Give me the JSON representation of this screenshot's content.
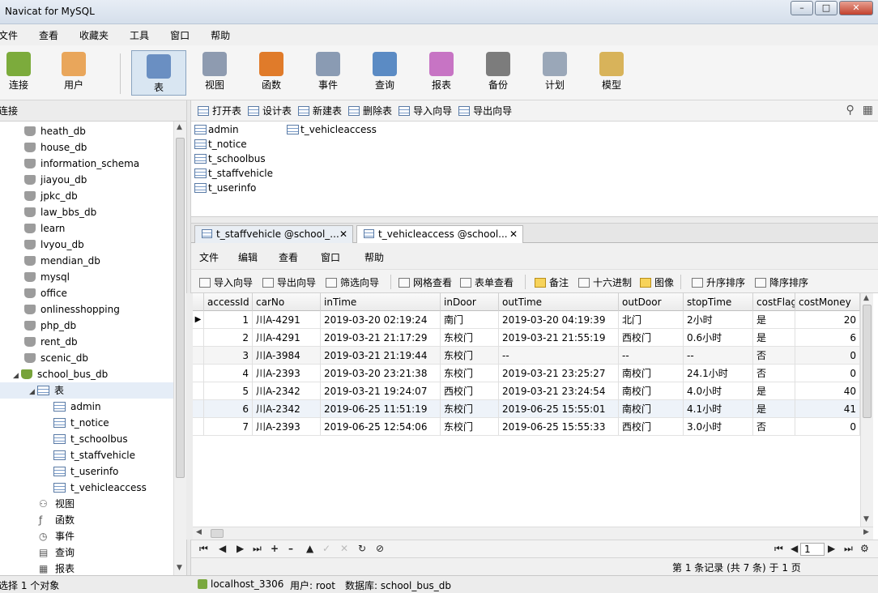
{
  "window": {
    "title": "Navicat for MySQL"
  },
  "main_menu": [
    "文件",
    "查看",
    "收藏夹",
    "工具",
    "窗口",
    "帮助"
  ],
  "toolbar": [
    {
      "label": "连接",
      "icon": "connection-icon",
      "color": "#7cab3c"
    },
    {
      "label": "用户",
      "icon": "user-icon",
      "color": "#e9a65b"
    },
    {
      "label": "表",
      "icon": "table-icon",
      "color": "#6a8fc2",
      "active": true
    },
    {
      "label": "视图",
      "icon": "view-icon",
      "color": "#8e9bb0"
    },
    {
      "label": "函数",
      "icon": "function-icon",
      "color": "#e07b2a"
    },
    {
      "label": "事件",
      "icon": "event-icon",
      "color": "#8a9bb3"
    },
    {
      "label": "查询",
      "icon": "query-icon",
      "color": "#5b8bc4"
    },
    {
      "label": "报表",
      "icon": "report-icon",
      "color": "#c774c4"
    },
    {
      "label": "备份",
      "icon": "backup-icon",
      "color": "#7c7c7c"
    },
    {
      "label": "计划",
      "icon": "schedule-icon",
      "color": "#9aa7b8"
    },
    {
      "label": "模型",
      "icon": "model-icon",
      "color": "#d8b35a"
    }
  ],
  "left_pane": {
    "header": "连接",
    "databases": [
      "heath_db",
      "house_db",
      "information_schema",
      "jiayou_db",
      "jpkc_db",
      "law_bbs_db",
      "learn",
      "lvyou_db",
      "mendian_db",
      "mysql",
      "office",
      "onlinesshopping",
      "php_db",
      "rent_db",
      "scenic_db"
    ],
    "open_db": "school_bus_db",
    "tables_node": "表",
    "tables": [
      "admin",
      "t_notice",
      "t_schoolbus",
      "t_staffvehicle",
      "t_userinfo",
      "t_vehicleaccess"
    ],
    "other_nodes": [
      {
        "label": "视图",
        "icon": "view-icon"
      },
      {
        "label": "函数",
        "icon": "function-icon"
      },
      {
        "label": "事件",
        "icon": "event-icon"
      },
      {
        "label": "查询",
        "icon": "query-icon"
      },
      {
        "label": "报表",
        "icon": "report-icon"
      }
    ]
  },
  "object_toolbar": [
    "打开表",
    "设计表",
    "新建表",
    "删除表",
    "导入向导",
    "导出向导"
  ],
  "object_list": {
    "col1": [
      "admin",
      "t_notice",
      "t_schoolbus",
      "t_staffvehicle",
      "t_userinfo"
    ],
    "col2": [
      "t_vehicleaccess"
    ]
  },
  "tabs": [
    {
      "label": "t_staffvehicle @school_...",
      "active": false
    },
    {
      "label": "t_vehicleaccess @school...",
      "active": true
    }
  ],
  "inner_menu": [
    "文件",
    "编辑",
    "查看",
    "窗口",
    "帮助"
  ],
  "inner_toolbar": [
    "导入向导",
    "导出向导",
    "筛选向导",
    "网格查看",
    "表单查看",
    "备注",
    "十六进制",
    "图像",
    "升序排序",
    "降序排序"
  ],
  "grid": {
    "columns": [
      "accessId",
      "carNo",
      "inTime",
      "inDoor",
      "outTime",
      "outDoor",
      "stopTime",
      "costFlag",
      "costMoney"
    ],
    "rows": [
      [
        "1",
        "川A-4291",
        "2019-03-20 02:19:24",
        "南门",
        "2019-03-20 04:19:39",
        "北门",
        "2小时",
        "是",
        "20"
      ],
      [
        "2",
        "川A-4291",
        "2019-03-21 21:17:29",
        "东校门",
        "2019-03-21 21:55:19",
        "西校门",
        "0.6小时",
        "是",
        "6"
      ],
      [
        "3",
        "川A-3984",
        "2019-03-21 21:19:44",
        "东校门",
        "--",
        "--",
        "--",
        "否",
        "0"
      ],
      [
        "4",
        "川A-2393",
        "2019-03-20 23:21:38",
        "东校门",
        "2019-03-21 23:25:27",
        "南校门",
        "24.1小时",
        "否",
        "0"
      ],
      [
        "5",
        "川A-2342",
        "2019-03-21 19:24:07",
        "西校门",
        "2019-03-21 23:24:54",
        "南校门",
        "4.0小时",
        "是",
        "40"
      ],
      [
        "6",
        "川A-2342",
        "2019-06-25 11:51:19",
        "东校门",
        "2019-06-25 15:55:01",
        "南校门",
        "4.1小时",
        "是",
        "41"
      ],
      [
        "7",
        "川A-2393",
        "2019-06-25 12:54:06",
        "东校门",
        "2019-06-25 15:55:33",
        "西校门",
        "3.0小时",
        "否",
        "0"
      ]
    ]
  },
  "navigator": {
    "page": "1"
  },
  "record_info": "第 1 条记录 (共 7 条) 于 1 页",
  "status": {
    "selection": "选择 1 个对象",
    "connection": "localhost_3306",
    "user": "用户: root",
    "database": "数据库: school_bus_db"
  }
}
